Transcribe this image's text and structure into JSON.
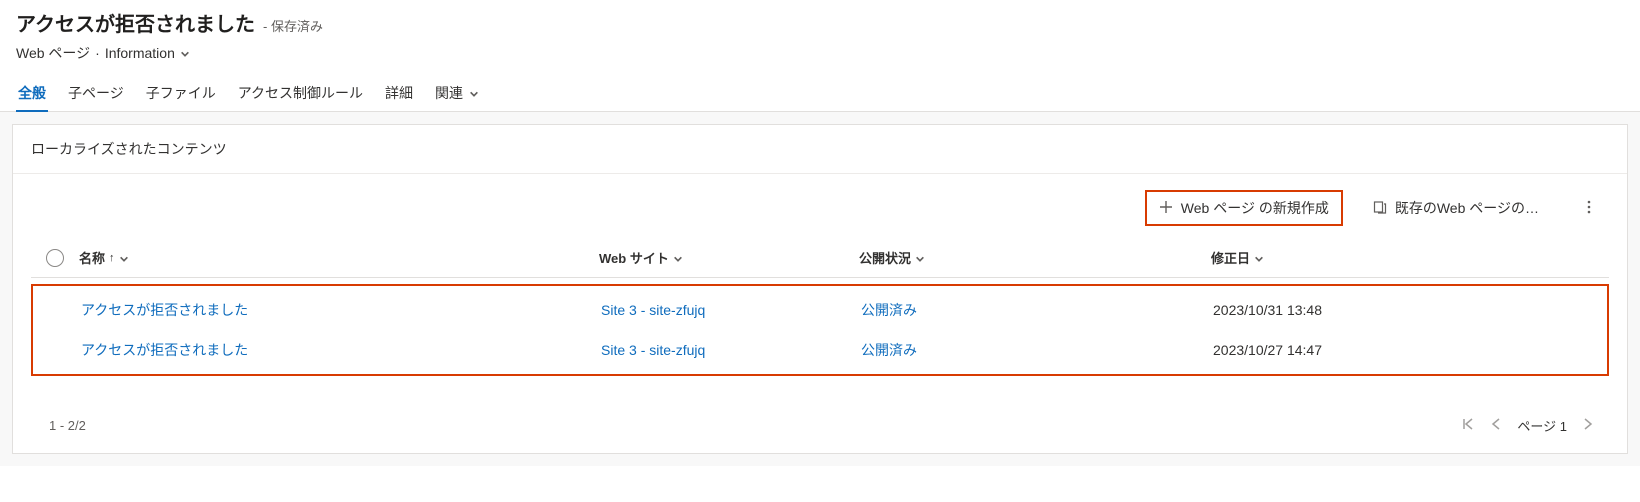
{
  "header": {
    "title": "アクセスが拒否されました",
    "saved_suffix": "- 保存済み",
    "breadcrumb_entity": "Web ページ",
    "breadcrumb_sep": "·",
    "breadcrumb_form": "Information"
  },
  "tabs": [
    {
      "label": "全般",
      "active": true
    },
    {
      "label": "子ページ"
    },
    {
      "label": "子ファイル"
    },
    {
      "label": "アクセス制御ルール"
    },
    {
      "label": "詳細"
    },
    {
      "label": "関連",
      "has_chevron": true
    }
  ],
  "section_title": "ローカライズされたコンテンツ",
  "grid_toolbar": {
    "new_label": "Web ページ の新規作成",
    "existing_label": "既存のWeb ページの…"
  },
  "columns": {
    "name": "名称",
    "website": "Web サイト",
    "publish": "公開状況",
    "modified": "修正日"
  },
  "sort_indicator": "↑",
  "rows": [
    {
      "name": "アクセスが拒否されました",
      "website": "Site 3 - site-zfujq",
      "publish": "公開済み",
      "modified": "2023/10/31 13:48"
    },
    {
      "name": "アクセスが拒否されました",
      "website": "Site 3 - site-zfujq",
      "publish": "公開済み",
      "modified": "2023/10/27 14:47"
    }
  ],
  "footer": {
    "range": "1 - 2/2",
    "page_label": "ページ 1"
  }
}
